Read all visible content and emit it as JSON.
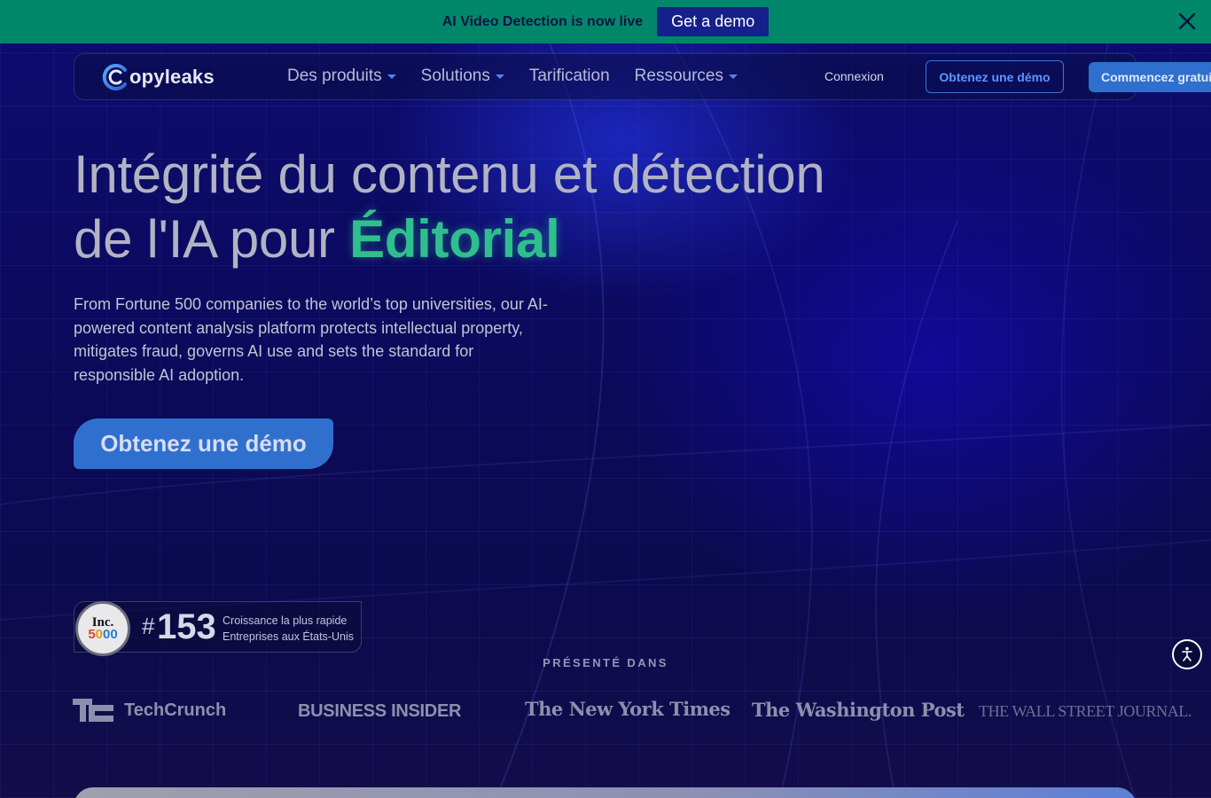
{
  "banner": {
    "text": "AI Video Detection is now live",
    "cta": "Get a demo",
    "close_icon": "close-icon"
  },
  "nav": {
    "logo_text": "opyleaks",
    "logo_icon": "copyleaks-c-icon",
    "links": [
      {
        "label": "Des produits",
        "dropdown": true
      },
      {
        "label": "Solutions",
        "dropdown": true
      },
      {
        "label": "Tarification",
        "dropdown": false
      },
      {
        "label": "Ressources",
        "dropdown": true
      }
    ],
    "login": "Connexion",
    "demo": "Obtenez une démo",
    "start": "Commencez gratuitement"
  },
  "hero": {
    "title_line1": "Intégrité du contenu et détection",
    "title_line2_prefix": "de l'IA pour ",
    "title_accent": "Éditorial",
    "subtitle": "From Fortune 500 companies to the world’s top universities, our AI-powered content analysis platform protects intellectual property, mitigates fraud, governs AI use and sets the standard for responsible AI adoption.",
    "cta": "Obtenez une démo"
  },
  "inc": {
    "seal_top": "Inc.",
    "seal_num": "5000",
    "hash": "#",
    "rank": "153",
    "desc_line1": "Croissance la plus rapide",
    "desc_line2": "Entreprises aux États-Unis"
  },
  "featured": {
    "label": "PRÉSENTÉ DANS",
    "logos": [
      "TechCrunch",
      "BUSINESS INSIDER",
      "The New York Times",
      "The Washington Post",
      "THE WALL STREET JOURNAL."
    ]
  },
  "accessibility_icon": "accessibility-icon",
  "colors": {
    "banner": "#00876a",
    "primary": "#2f70cf",
    "accent": "#2fbf8e",
    "background": "#0c0a55"
  }
}
